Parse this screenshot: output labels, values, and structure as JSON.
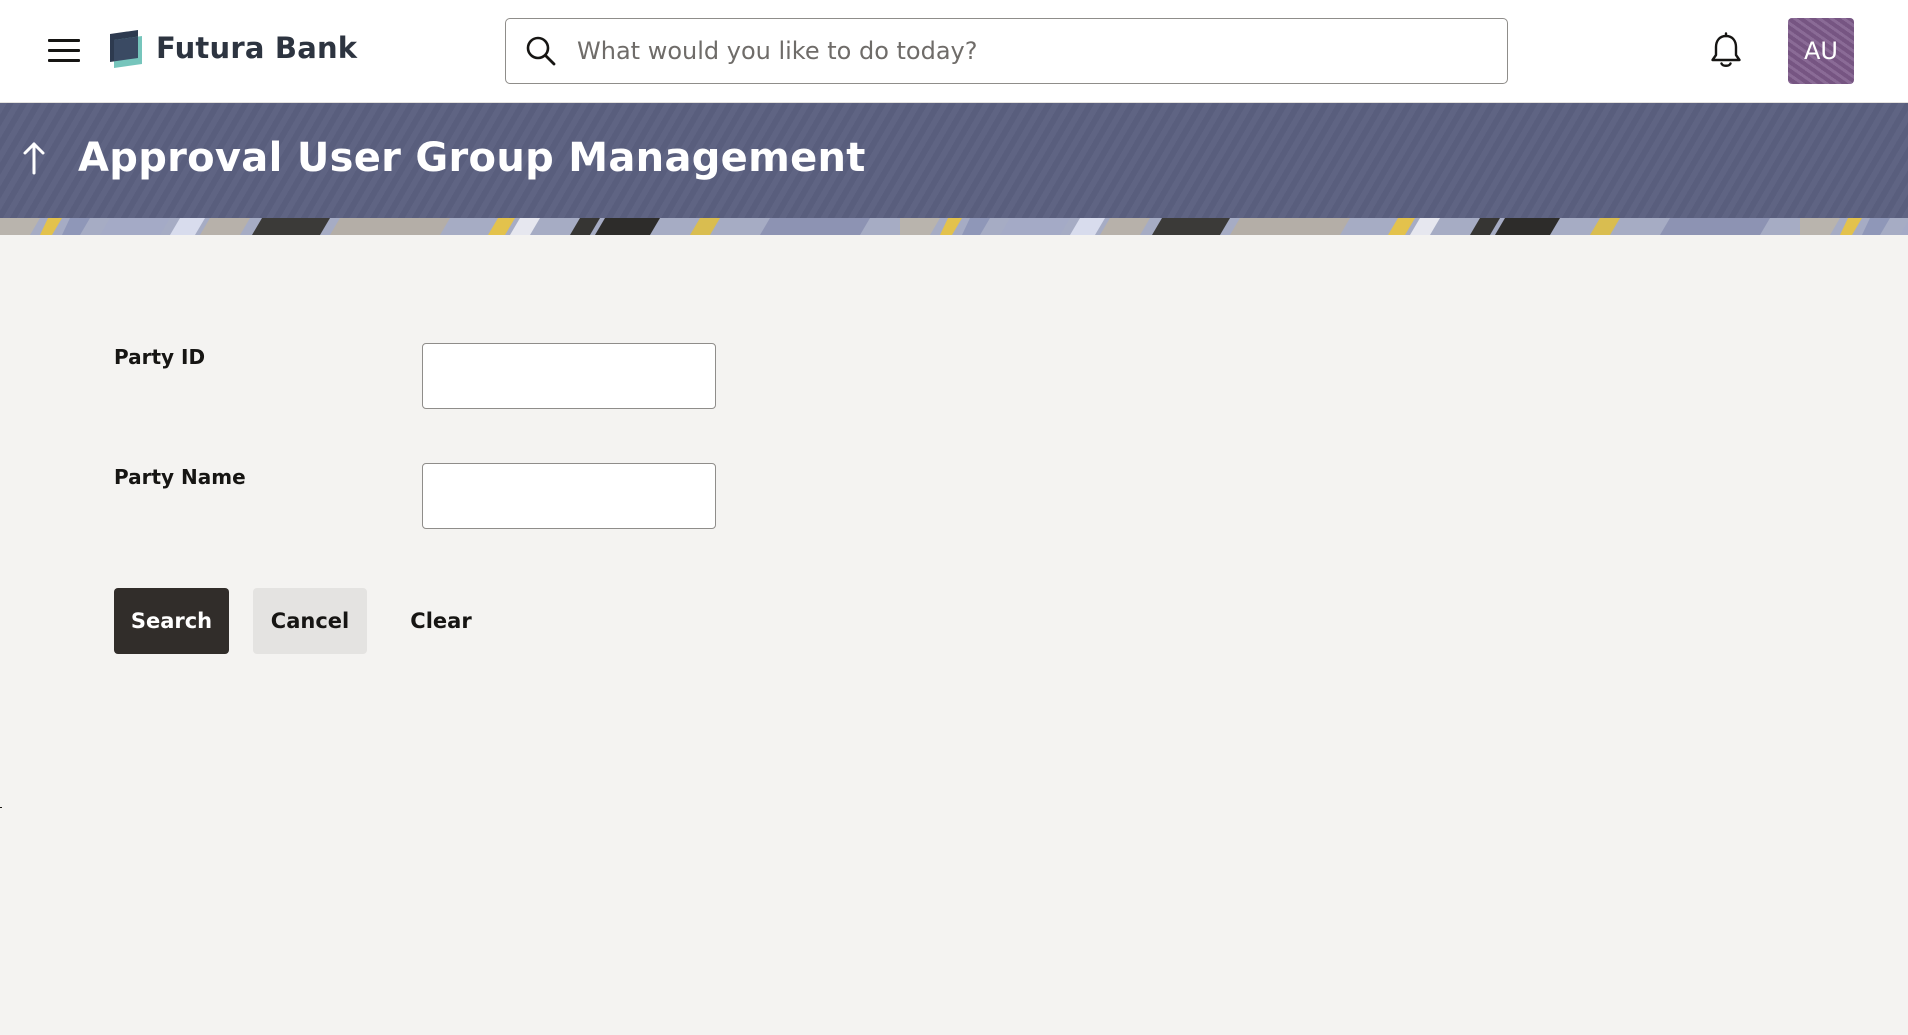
{
  "app": {
    "brand_name": "Futura Bank",
    "menu_icon": "hamburger-menu-icon",
    "logo_icon": "futura-bank-logo"
  },
  "header": {
    "search": {
      "placeholder": "What would you like to do today?",
      "value": "",
      "icon": "search-icon"
    },
    "notifications_icon": "bell-icon",
    "avatar_initials": "AU",
    "avatar_color": "#7d5a8a"
  },
  "page": {
    "title": "Approval User Group Management",
    "back_icon": "arrow-up-icon",
    "banner_color": "#5b6080"
  },
  "form": {
    "party_id": {
      "label": "Party ID",
      "value": ""
    },
    "party_name": {
      "label": "Party Name",
      "value": ""
    }
  },
  "actions": {
    "search_label": "Search",
    "cancel_label": "Cancel",
    "clear_label": "Clear"
  },
  "colors": {
    "primary_button": "#312d2a",
    "secondary_button": "#e4e3e1",
    "content_background": "#f4f3f1"
  }
}
